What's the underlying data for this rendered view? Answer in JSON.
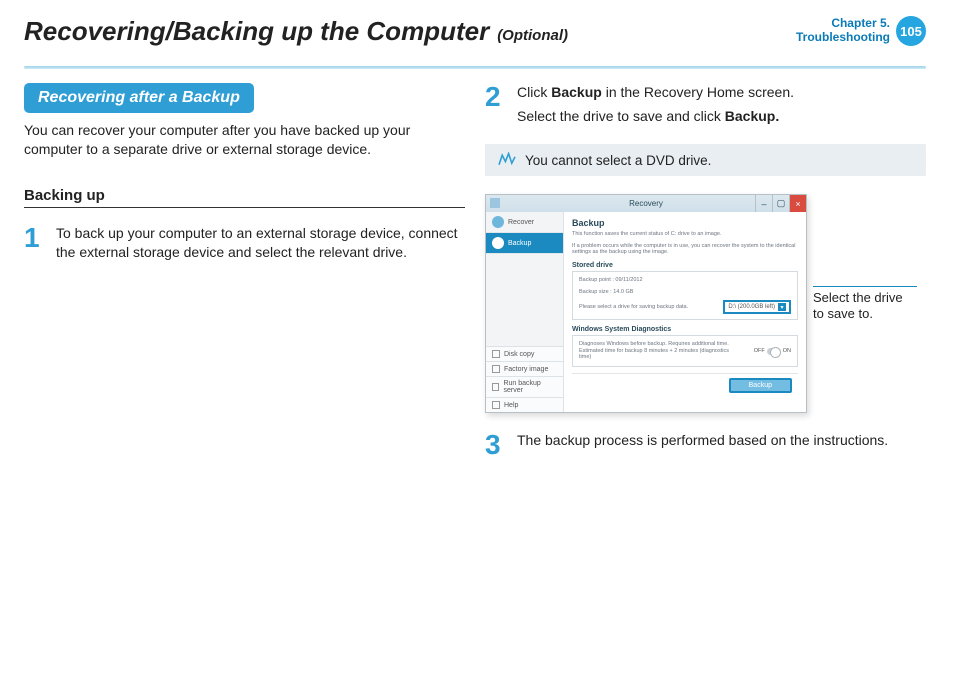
{
  "header": {
    "title": "Recovering/Backing up the Computer",
    "subtitle": "(Optional)",
    "chapter_line1": "Chapter 5.",
    "chapter_line2": "Troubleshooting",
    "page_number": "105"
  },
  "left": {
    "section_title": "Recovering after a Backup",
    "intro": "You can recover your computer after you have backed up your computer to a separate drive or external storage device.",
    "subhead": "Backing up",
    "step1_num": "1",
    "step1_text": "To back up your computer to an external storage device, connect the external storage device and select the relevant drive."
  },
  "right": {
    "step2_num": "2",
    "step2_line1_a": "Click ",
    "step2_line1_bold": "Backup",
    "step2_line1_b": " in the Recovery Home screen.",
    "step2_line2_a": "Select the drive to save and click ",
    "step2_line2_bold": "Backup.",
    "note": "You cannot select a DVD drive.",
    "callout": "Select the drive to save to.",
    "step3_num": "3",
    "step3_text": "The backup process is performed based on the instructions."
  },
  "app": {
    "title": "Recovery",
    "side_recover": "Recover",
    "side_backup": "Backup",
    "side_disk_copy": "Disk copy",
    "side_factory_image": "Factory image",
    "side_run_backup": "Run backup server",
    "side_help": "Help",
    "panel_title": "Backup",
    "desc1": "This function saves the current status of C: drive to an image.",
    "desc2": "If a problem occurs while the computer is in use, you can recover the system to the identical settings as the backup using the image.",
    "stored_drive": "Stored drive",
    "backup_point": "Backup point : 09/11/2012",
    "backup_size": "Backup size : 14.0 GB",
    "select_prompt": "Please select a drive for saving backup data.",
    "drive_value": "D:\\ (200.0GB left)",
    "diagnostics_head": "Windows System Diagnostics",
    "diag_line": "Diagnoses Windows before backup. Requires additional time. Estimated time for backup 8 minutes + 2 minutes (diagnostics time)",
    "off": "OFF",
    "on": "ON",
    "backup_btn": "Backup"
  }
}
